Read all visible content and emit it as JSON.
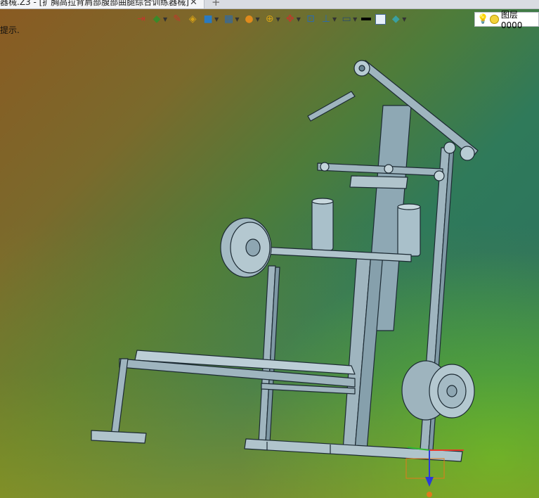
{
  "tab": {
    "title": "器械.Z3 - [扩胸高拉背肩部腹部曲腿综合训练器械]",
    "close_glyph": "✕",
    "add_glyph": "+"
  },
  "hint": "提示.",
  "toolbar": {
    "items": [
      {
        "icon": "exit-sketch-icon",
        "glyph": "⇥"
      },
      {
        "icon": "feature-icon",
        "glyph": "◆"
      },
      {
        "icon": "pen-icon",
        "glyph": "✎"
      },
      {
        "icon": "layer-stack-icon",
        "glyph": "◈"
      },
      {
        "icon": "cube-icon",
        "glyph": "■"
      },
      {
        "icon": "assembly-icon",
        "glyph": "▦"
      },
      {
        "icon": "render-sphere-icon",
        "glyph": "●"
      },
      {
        "icon": "zoom-icon",
        "glyph": "⊕"
      },
      {
        "icon": "snap-icon",
        "glyph": "✥"
      },
      {
        "icon": "view-fit-icon",
        "glyph": "⊡"
      },
      {
        "icon": "align-icon",
        "glyph": "⊥"
      },
      {
        "icon": "display-icon",
        "glyph": "▭"
      }
    ]
  },
  "layer": {
    "label": "图层0000"
  },
  "colors": {
    "model_line": "#1c2a33",
    "model_fill": "#9fb5bf",
    "axis_x": "#e53b2b",
    "axis_y": "#2fb82f",
    "axis_z": "#2a3bd8",
    "origin_box": "#e07a1c"
  }
}
